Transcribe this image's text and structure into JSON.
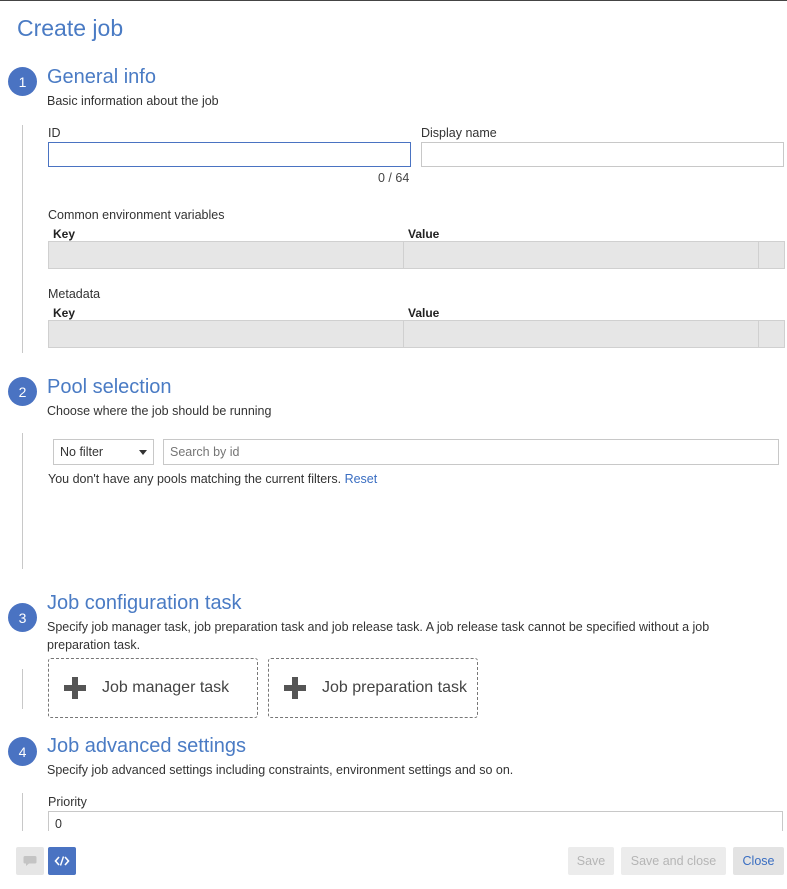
{
  "page": {
    "title": "Create job"
  },
  "steps": [
    {
      "number": "1",
      "title": "General info",
      "description": "Basic information about the job"
    },
    {
      "number": "2",
      "title": "Pool selection",
      "description": "Choose where the job should be running"
    },
    {
      "number": "3",
      "title": "Job configuration task",
      "description": "Specify job manager task, job preparation task and job release task. A job release task cannot be specified without a job preparation task."
    },
    {
      "number": "4",
      "title": "Job advanced settings",
      "description": "Specify job advanced settings including constraints, environment settings and so on."
    }
  ],
  "general": {
    "id_label": "ID",
    "id_value": "",
    "id_counter": "0 / 64",
    "display_name_label": "Display name",
    "display_name_value": "",
    "env_label": "Common environment variables",
    "metadata_label": "Metadata",
    "key_header": "Key",
    "value_header": "Value"
  },
  "pool": {
    "filter_value": "No filter",
    "search_placeholder": "Search by id",
    "empty_message": "You don't have any pools matching the current filters.",
    "reset_link": "Reset"
  },
  "job_config": {
    "manager_task_label": "Job manager task",
    "preparation_task_label": "Job preparation task"
  },
  "advanced": {
    "priority_label": "Priority",
    "priority_value": "0"
  },
  "footer": {
    "save_label": "Save",
    "save_close_label": "Save and close",
    "close_label": "Close",
    "accent_color": "#4a73c2"
  },
  "icons": {
    "feedback": "speech-bubble-icon",
    "code": "code-icon",
    "add": "plus-icon"
  }
}
